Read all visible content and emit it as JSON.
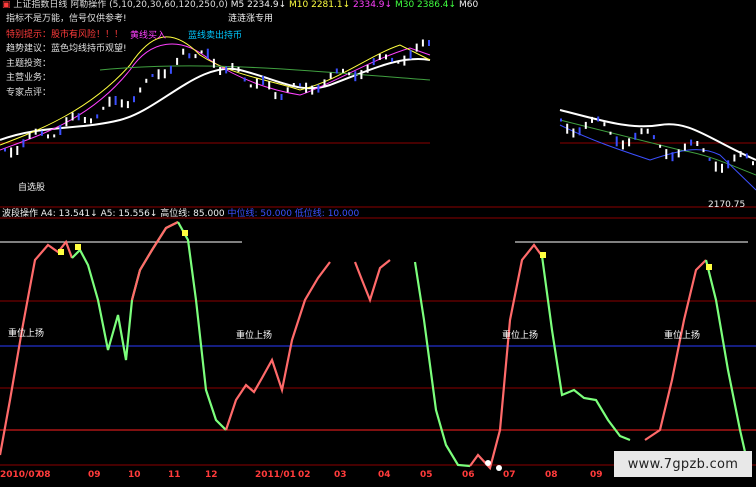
{
  "header": {
    "chart_title": "上证指数日线",
    "indicator_name": "阿勒操作",
    "ma_params": "(5,10,20,30,60,120,250,0)",
    "ma_values": [
      {
        "label": "M5",
        "value": "2234.9↓",
        "color": "#f0f0f0"
      },
      {
        "label": "M10",
        "value": "2281.1↓",
        "color": "#ffff40"
      },
      {
        "label": "",
        "value": "2334.9↓",
        "color": "#ff40ff"
      },
      {
        "label": "M30",
        "value": "2386.4↓",
        "color": "#40ff40"
      },
      {
        "label": "M60",
        "value": "",
        "color": "#f0f0f0"
      }
    ]
  },
  "info_panel": {
    "line1": "指标不是万能，信号仅供参考!",
    "line2": "特别提示：股市有风险！！！",
    "line3": "趋势建议：蓝色均线持币观望!",
    "line4": "主题投资：",
    "line5": "主营业务：",
    "line6": "专家点评：",
    "tag_right": "涟涟涨专用",
    "note_magenta": "黄线买入",
    "note_cyan": "蓝线卖出持币",
    "stock_selector": "自选股"
  },
  "upper_axis": {
    "last_price": "2170.75"
  },
  "lower_header": {
    "name": "波段操作",
    "a4": "A4: 13.541↓",
    "a5": "A5: 15.556↓",
    "high_line": "高位线: 85.000",
    "mid_line": "中位线: 50.000",
    "low_line": "低位线: 10.000"
  },
  "lower_labels": {
    "signal_text": "重位上扬",
    "signal_text2": "重位上扬",
    "signal_text3": "重位上扬",
    "signal_text4": "重位上扬"
  },
  "x_axis": {
    "labels": [
      "2010/07",
      "08",
      "09",
      "10",
      "11",
      "12",
      "2011/01",
      "02",
      "03",
      "04",
      "05",
      "06",
      "07",
      "08",
      "09"
    ]
  },
  "watermark": "www.7gpzb.com",
  "colors": {
    "background": "#000000",
    "kline_white": "#ffffff",
    "kline_blue": "#3c50ff",
    "osc_up": "#ff6a6a",
    "osc_down": "#7cff7c",
    "ref_red": "#ff2020",
    "ref_blue": "#2020ff",
    "ref_white": "#ffffff"
  }
}
